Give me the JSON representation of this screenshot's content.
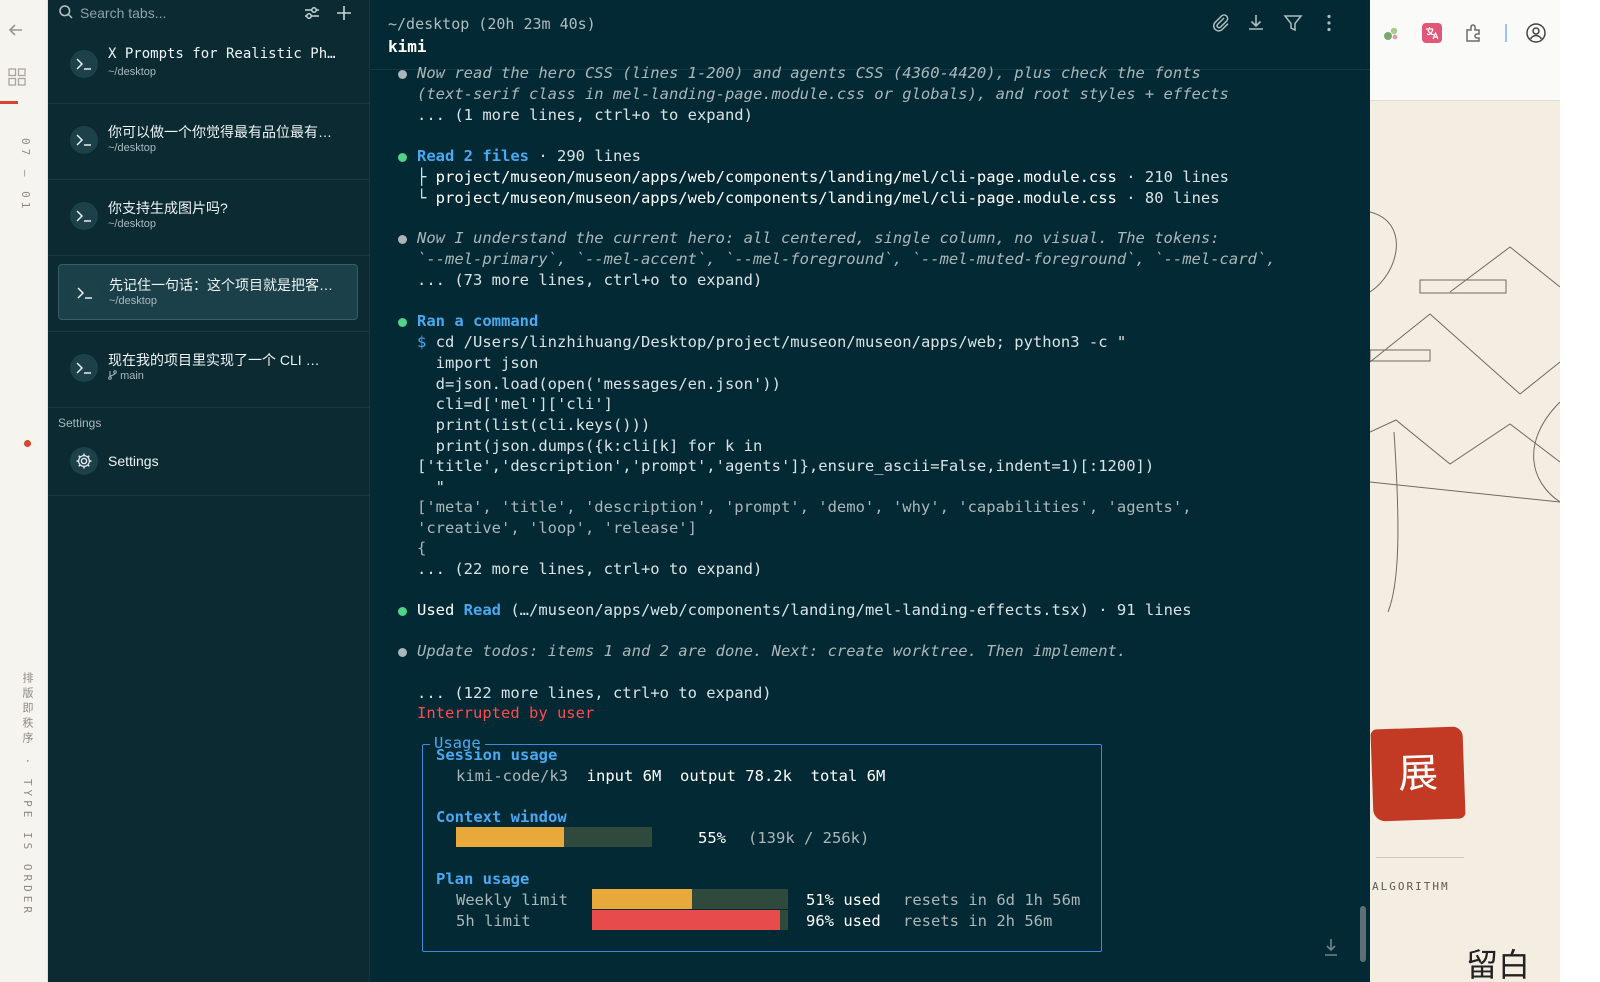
{
  "left_strip": {
    "date_vertical": "07 — 01",
    "tagline_vertical": "排版即秩序 · TYPE IS ORDER"
  },
  "sidebar": {
    "search_placeholder": "Search tabs...",
    "tabs": [
      {
        "title": "X Prompts for Realistic Ph…",
        "subtitle": "~/desktop"
      },
      {
        "title": "你可以做一个你觉得最有品位最有…",
        "subtitle": "~/desktop"
      },
      {
        "title": "你支持生成图片吗?",
        "subtitle": "~/desktop"
      },
      {
        "title": "先记住一句话：这个项目就是把客…",
        "subtitle": "~/desktop"
      },
      {
        "title": "现在我的项目里实现了一个 CLI …",
        "subtitle": "main"
      }
    ],
    "settings_section_label": "Settings",
    "settings_item_label": "Settings"
  },
  "terminal": {
    "path": "~/desktop (20h 23m 40s)",
    "title": "kimi",
    "msg1": {
      "lines": [
        "Now read the hero CSS (lines 1-200) and agents CSS (4360-4420), plus check the fonts",
        "(text-serif class in mel-landing-page.module.css or globals), and root styles + effects"
      ],
      "more": "... (1 more lines, ctrl+o to expand)"
    },
    "read_files": {
      "action": "Read 2 files",
      "count": "· 290 lines",
      "file1": "project/museon/museon/apps/web/components/landing/mel/cli-page.module.css",
      "file1_count": "· 210 lines",
      "file2": "project/museon/museon/apps/web/components/landing/mel/cli-page.module.css",
      "file2_count": "· 80 lines"
    },
    "msg2": {
      "lines": [
        "Now I understand the current hero: all centered, single column, no visual. The tokens:",
        "`--mel-primary`, `--mel-accent`, `--mel-foreground`, `--mel-muted-foreground`, `--mel-card`,"
      ],
      "more": "... (73 more lines, ctrl+o to expand)"
    },
    "command": {
      "action": "Ran a command",
      "prompt": "$",
      "lines": [
        "cd /Users/linzhihuang/Desktop/project/museon/museon/apps/web; python3 -c \"",
        "  import json",
        "  d=json.load(open('messages/en.json'))",
        "  cli=d['mel']['cli']",
        "  print(list(cli.keys()))",
        "  print(json.dumps({k:cli[k] for k in",
        "['title','description','prompt','agents']},ensure_ascii=False,indent=1)[:1200])",
        "  \""
      ],
      "output": [
        "['meta', 'title', 'description', 'prompt', 'demo', 'why', 'capabilities', 'agents',",
        "'creative', 'loop', 'release']",
        "{"
      ],
      "more": "... (22 more lines, ctrl+o to expand)"
    },
    "used": {
      "prefix": "Used",
      "tool": "Read",
      "detail": "(…/museon/apps/web/components/landing/mel-landing-effects.tsx) · 91 lines"
    },
    "msg3": "Update todos: items 1 and 2 are done. Next: create worktree. Then implement.",
    "more_final": "... (122 more lines, ctrl+o to expand)",
    "interrupted": "Interrupted by user",
    "usage": {
      "legend": "Usage",
      "session_heading": "Session usage",
      "model": "kimi-code/k3",
      "input": "input 6M",
      "output": "output 78.2k",
      "total": "total 6M",
      "context_heading": "Context window",
      "context_percent": "55%",
      "context_detail": "(139k / 256k)",
      "context_fraction": 0.55,
      "plan_heading": "Plan usage",
      "weekly_label": "Weekly limit",
      "weekly_used": "51% used",
      "weekly_reset": "resets in 6d 1h 56m",
      "weekly_fraction": 0.51,
      "fivehour_label": "5h limit",
      "fivehour_used": "96% used",
      "fivehour_reset": "resets in 2h 56m",
      "fivehour_fraction": 0.96
    }
  },
  "right_page": {
    "seal_char": "展",
    "algorithm_label": "ALGORITHM",
    "bottom_script": "留白"
  },
  "colors": {
    "terminal_bg": "#032a34",
    "sidebar_bg": "#0b2a32",
    "accent_blue": "#4aa8f0",
    "bar_yellow": "#e9a83a",
    "bar_red": "#e74b4b",
    "bar_track": "#2f4a3c",
    "bullet_green": "#4fd48a",
    "interrupt_red": "#ff4b4b",
    "seal_red": "#c23a24"
  }
}
